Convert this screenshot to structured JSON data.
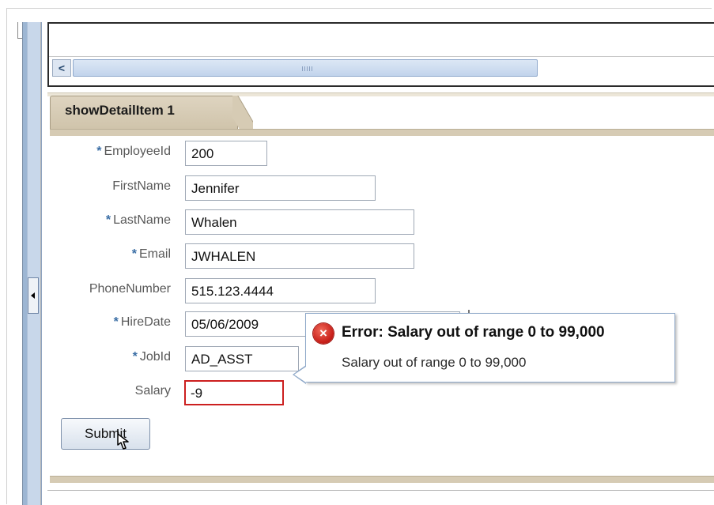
{
  "tab": {
    "label": "showDetailItem 1"
  },
  "scrollbar": {
    "left_arrow": "<"
  },
  "form": {
    "fields": [
      {
        "required": true,
        "label": "EmployeeId",
        "value": "200"
      },
      {
        "required": false,
        "label": "FirstName",
        "value": "Jennifer"
      },
      {
        "required": true,
        "label": "LastName",
        "value": "Whalen"
      },
      {
        "required": true,
        "label": "Email",
        "value": "JWHALEN"
      },
      {
        "required": false,
        "label": "PhoneNumber",
        "value": "515.123.4444"
      },
      {
        "required": true,
        "label": "HireDate",
        "value": "05/06/2009"
      },
      {
        "required": true,
        "label": "JobId",
        "value": "AD_ASST"
      },
      {
        "required": false,
        "label": "Salary",
        "value": "-9",
        "error": true
      }
    ],
    "required_marker": "*"
  },
  "error_popup": {
    "icon": "error-x-icon",
    "icon_glyph": "×",
    "title": "Error: Salary out of range 0 to 99,000",
    "message": "Salary out of range 0 to 99,000"
  },
  "submit": {
    "label": "Submit"
  },
  "colors": {
    "required_marker": "#3a6ea5",
    "error_border": "#cc1f1f",
    "tab_bg": "#d6cbb4",
    "scroll_thumb": "#c2d4ec"
  }
}
